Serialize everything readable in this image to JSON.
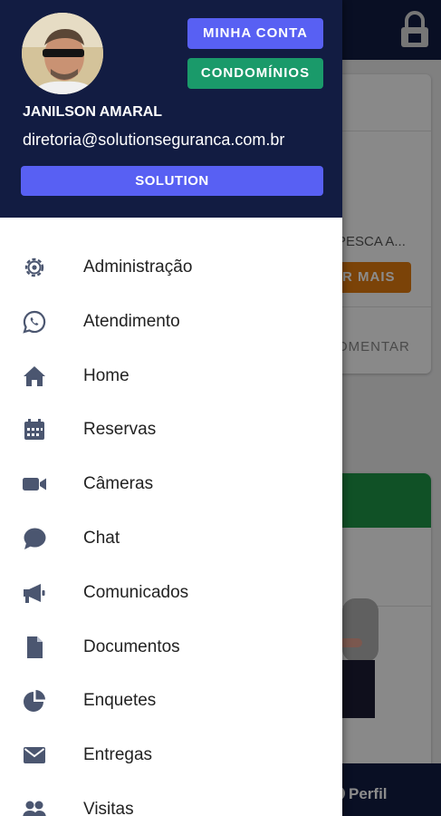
{
  "colors": {
    "header_bg": "#121c42",
    "accent_blue": "#5860f3",
    "accent_green": "#1a9a6a",
    "icon_color": "#4b5670",
    "orange": "#e07a10"
  },
  "drawer": {
    "buttons": {
      "account": "MINHA CONTA",
      "condos": "CONDOMÍNIOS",
      "solution": "SOLUTION"
    },
    "user": {
      "name": "JANILSON AMARAL",
      "email": "diretoria@solutionseguranca.com.br"
    },
    "menu": [
      {
        "label": "Administração",
        "icon": "gear-icon"
      },
      {
        "label": "Atendimento",
        "icon": "whatsapp-icon"
      },
      {
        "label": "Home",
        "icon": "home-icon"
      },
      {
        "label": "Reservas",
        "icon": "calendar-icon"
      },
      {
        "label": "Câmeras",
        "icon": "video-camera-icon"
      },
      {
        "label": "Chat",
        "icon": "chat-bubble-icon"
      },
      {
        "label": "Comunicados",
        "icon": "megaphone-icon"
      },
      {
        "label": "Documentos",
        "icon": "document-icon"
      },
      {
        "label": "Enquetes",
        "icon": "pie-chart-icon"
      },
      {
        "label": "Entregas",
        "icon": "envelope-icon"
      },
      {
        "label": "Visitas",
        "icon": "users-icon"
      }
    ]
  },
  "background": {
    "snippet_text": "PESCA A...",
    "orange_button": "R MAIS",
    "comment_button": "OMENTAR",
    "bottom_nav_label": "Perfil"
  }
}
